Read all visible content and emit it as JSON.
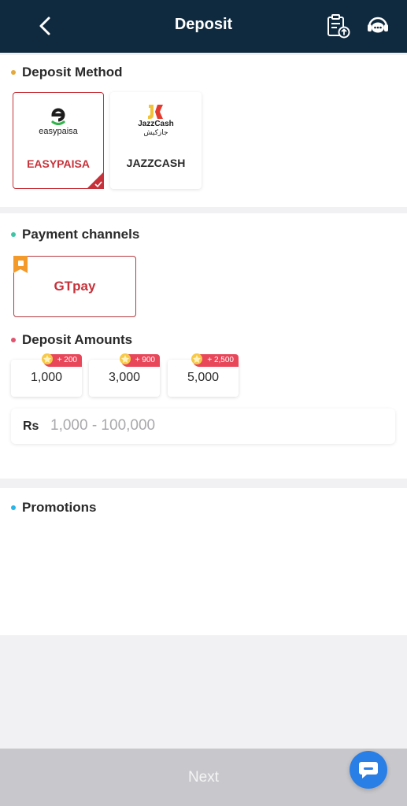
{
  "header": {
    "title": "Deposit",
    "back_icon": "chevron-left-icon",
    "records_icon": "clipboard-upload-icon",
    "support_icon": "customer-service-icon"
  },
  "deposit_method": {
    "title": "Deposit Method",
    "dot_color": "#e5a83a",
    "methods": [
      {
        "label": "EASYPAISA",
        "logo_text": "easypaisa",
        "selected": true
      },
      {
        "label": "JAZZCASH",
        "logo_text": "JazzCash",
        "logo_subtext": "جازکیش",
        "selected": false
      }
    ]
  },
  "payment_channels": {
    "title": "Payment channels",
    "dot_color": "#3cc6a6",
    "channels": [
      {
        "label": "GTpay",
        "selected": true
      }
    ]
  },
  "deposit_amounts": {
    "title": "Deposit Amounts",
    "dot_color": "#e05470",
    "options": [
      {
        "value": "1,000",
        "bonus": "+ 200"
      },
      {
        "value": "3,000",
        "bonus": "+ 900"
      },
      {
        "value": "5,000",
        "bonus": "+ 2,500"
      }
    ],
    "currency_label": "Rs",
    "input_placeholder": "1,000 - 100,000",
    "input_value": ""
  },
  "promotions": {
    "title": "Promotions",
    "dot_color": "#2bb4e6"
  },
  "footer": {
    "next_label": "Next"
  },
  "colors": {
    "header_bg": "#0f2a3f",
    "accent_red": "#c7323a",
    "bonus_pink": "#e8475a",
    "footer_bg": "#c8c8cc",
    "chat_blue": "#2a7fe6"
  }
}
